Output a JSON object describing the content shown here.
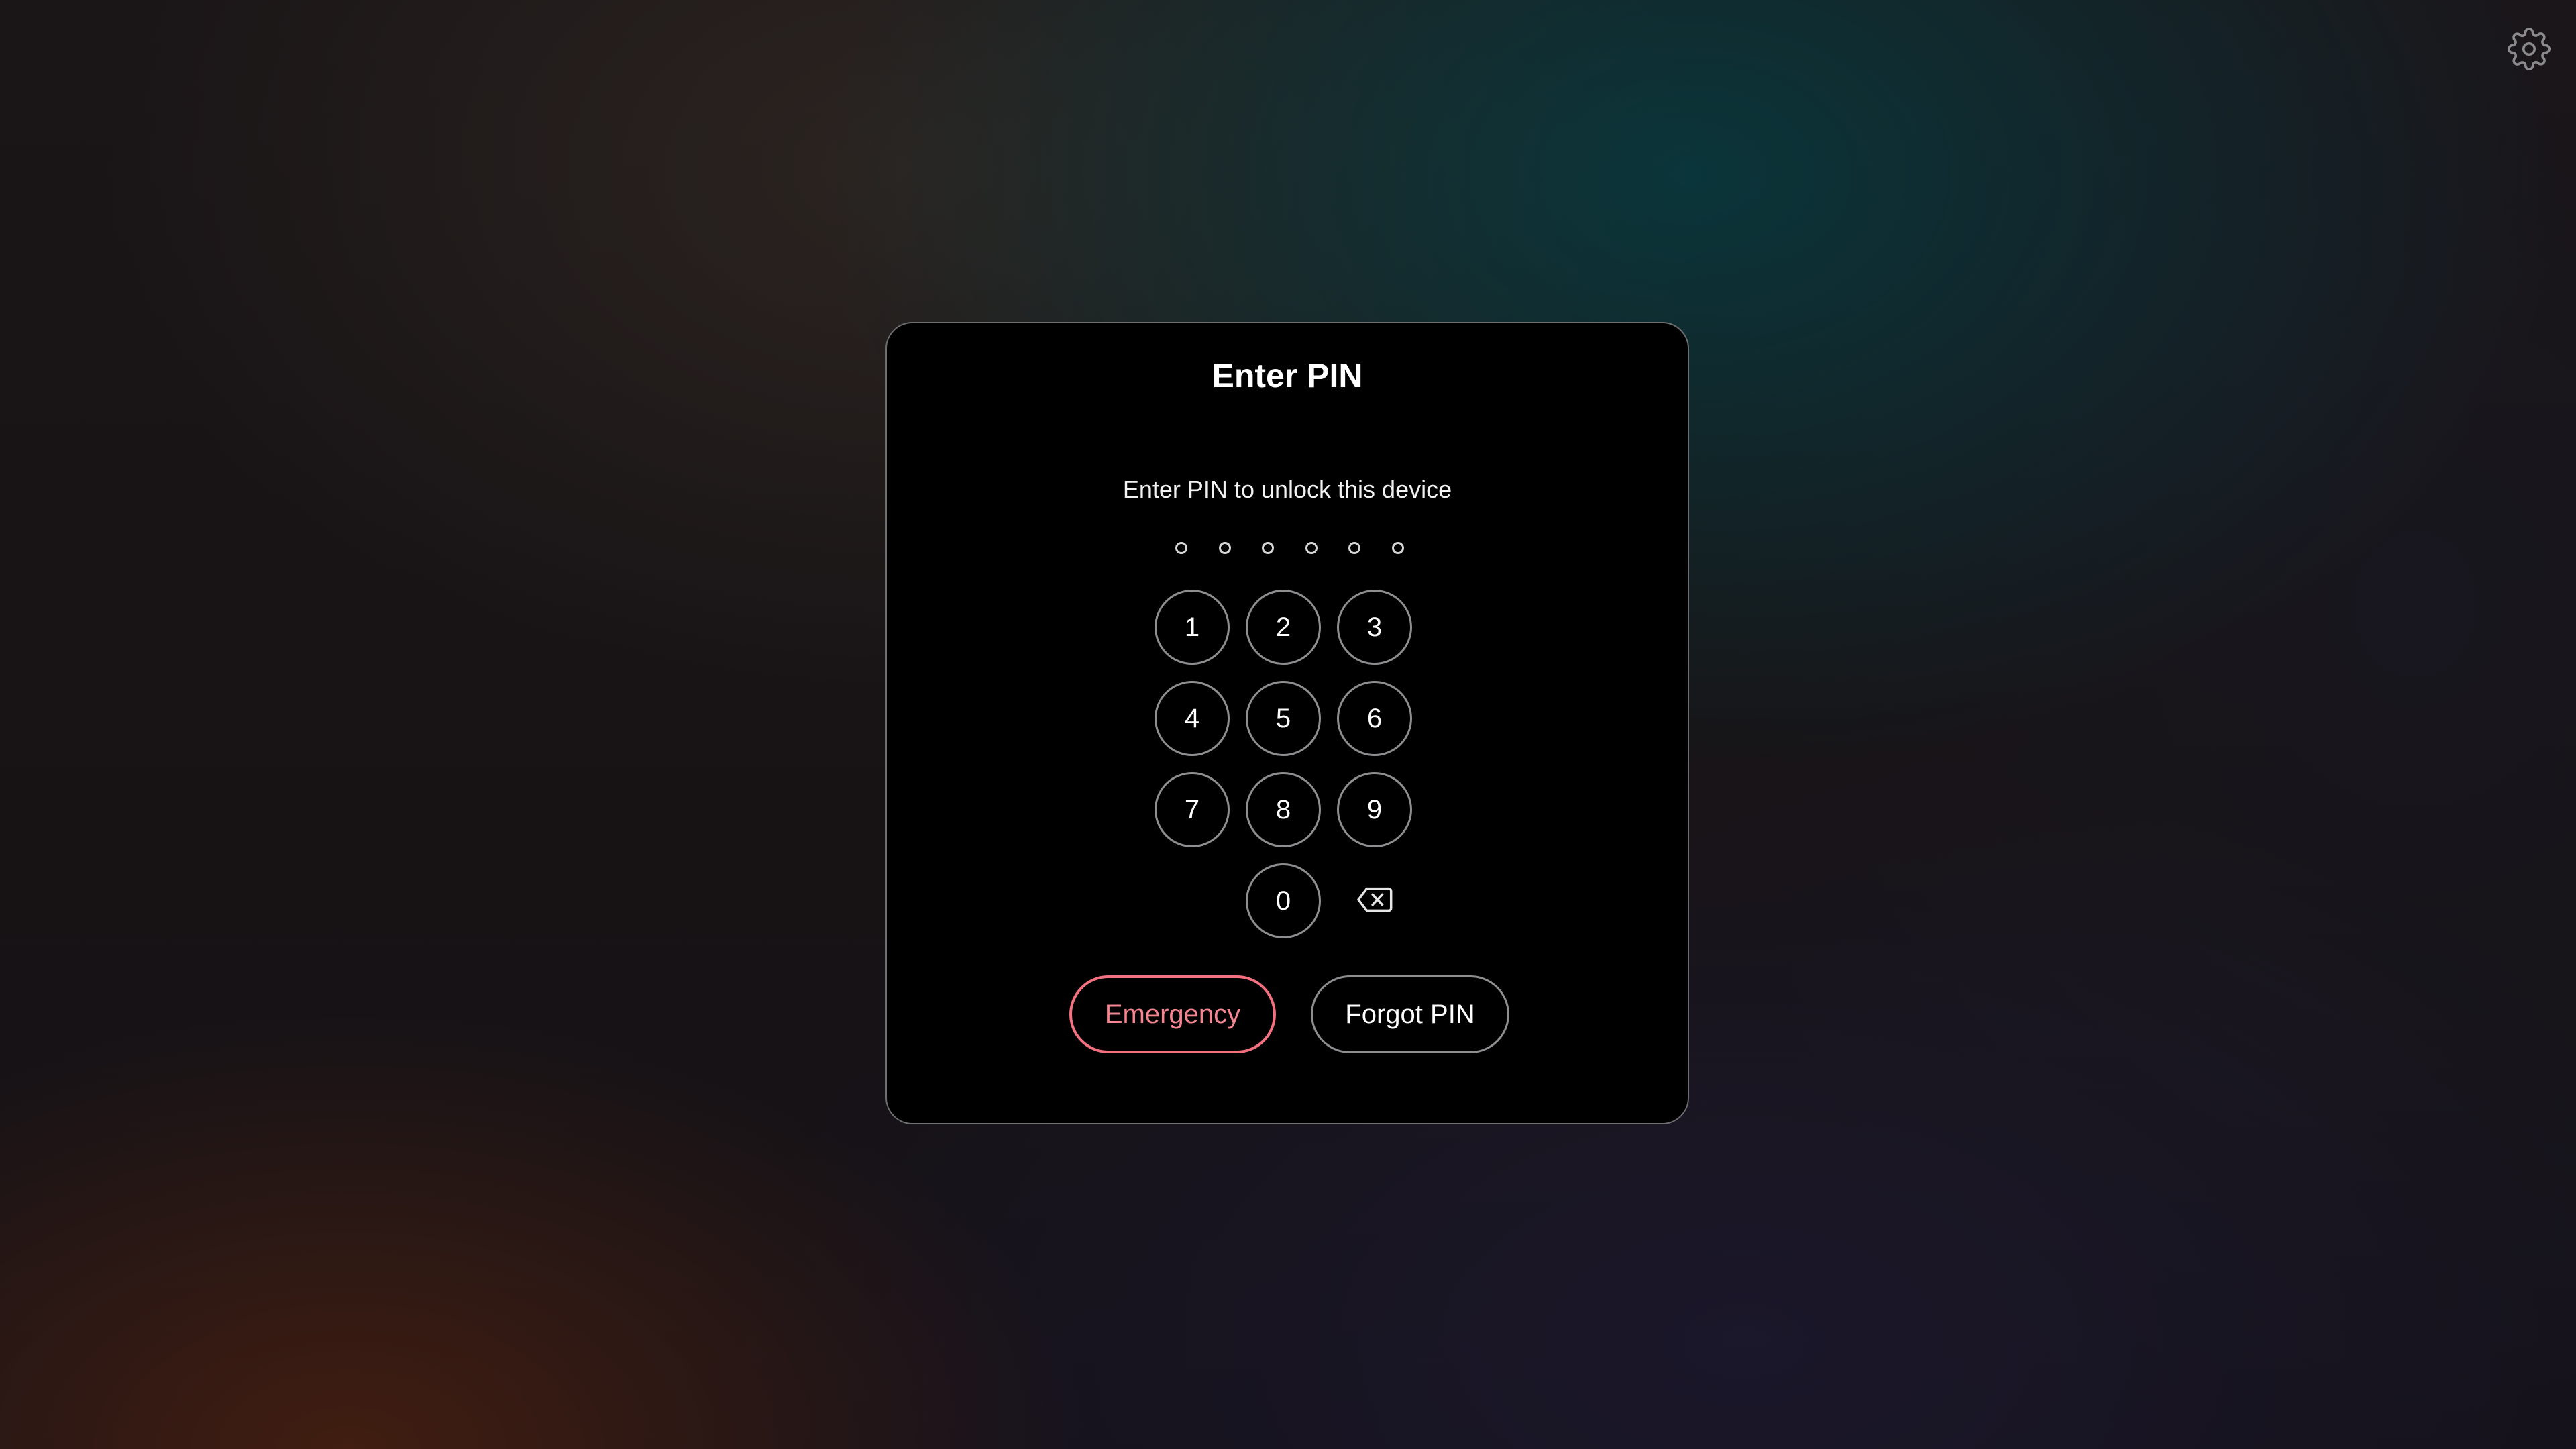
{
  "settings": {
    "icon": "gear-icon"
  },
  "dialog": {
    "title": "Enter PIN",
    "subtitle": "Enter PIN to unlock this device",
    "pin_length": 6,
    "pin_entered": 0,
    "keypad": {
      "keys": [
        "1",
        "2",
        "3",
        "4",
        "5",
        "6",
        "7",
        "8",
        "9",
        "0"
      ],
      "backspace_icon": "backspace-icon"
    },
    "emergency_label": "Emergency",
    "forgot_label": "Forgot PIN"
  },
  "colors": {
    "emergency_accent": "#f2707f",
    "dialog_background": "#000000",
    "key_border": "#8e8e91"
  }
}
